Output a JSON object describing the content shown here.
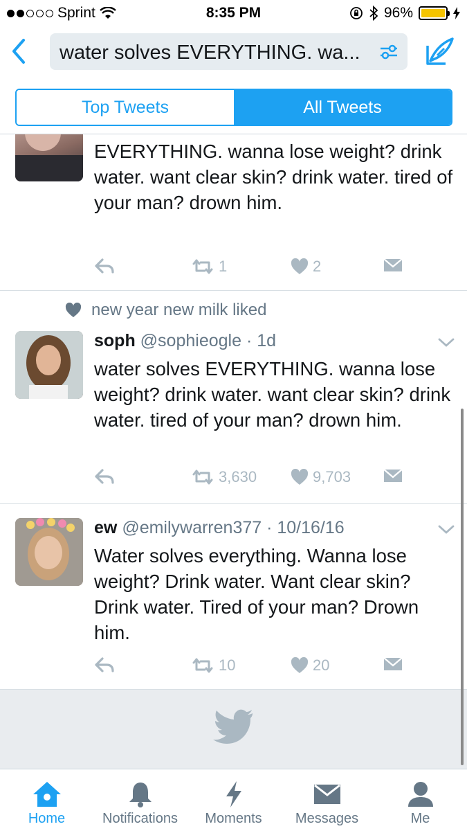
{
  "status_bar": {
    "carrier": "Sprint",
    "time": "8:35 PM",
    "battery_percent": "96%",
    "battery_level": 0.96
  },
  "search": {
    "query": "water solves EVERYTHING. wa..."
  },
  "tabs": {
    "top_label": "Top Tweets",
    "all_label": "All Tweets",
    "selected": "All Tweets"
  },
  "tweets": [
    {
      "text": "EVERYTHING. wanna lose weight? drink water. want clear skin? drink water. tired of your man? drown him.",
      "retweets": "1",
      "likes": "2"
    },
    {
      "social_context": "new year new milk liked",
      "name": "soph",
      "handle": "@sophieogle",
      "time": "1d",
      "text": "water solves EVERYTHING. wanna lose weight? drink water. want clear skin? drink water. tired of your man? drown him.",
      "retweets": "3,630",
      "likes": "9,703"
    },
    {
      "name": "ew",
      "handle": "@emilywarren377",
      "time": "10/16/16",
      "text": "Water solves everything. Wanna lose weight? Drink water. Want clear skin? Drink water. Tired of your man? Drown him.",
      "retweets": "10",
      "likes": "20"
    }
  ],
  "tabbar": {
    "items": [
      {
        "label": "Home",
        "icon": "home-icon",
        "active": true
      },
      {
        "label": "Notifications",
        "icon": "bell-icon"
      },
      {
        "label": "Moments",
        "icon": "lightning-icon"
      },
      {
        "label": "Messages",
        "icon": "envelope-icon"
      },
      {
        "label": "Me",
        "icon": "person-icon"
      }
    ]
  },
  "colors": {
    "accent": "#1da1f2",
    "text_secondary": "#657786",
    "icon_gray": "#aab8c2",
    "battery": "#f5c400"
  }
}
